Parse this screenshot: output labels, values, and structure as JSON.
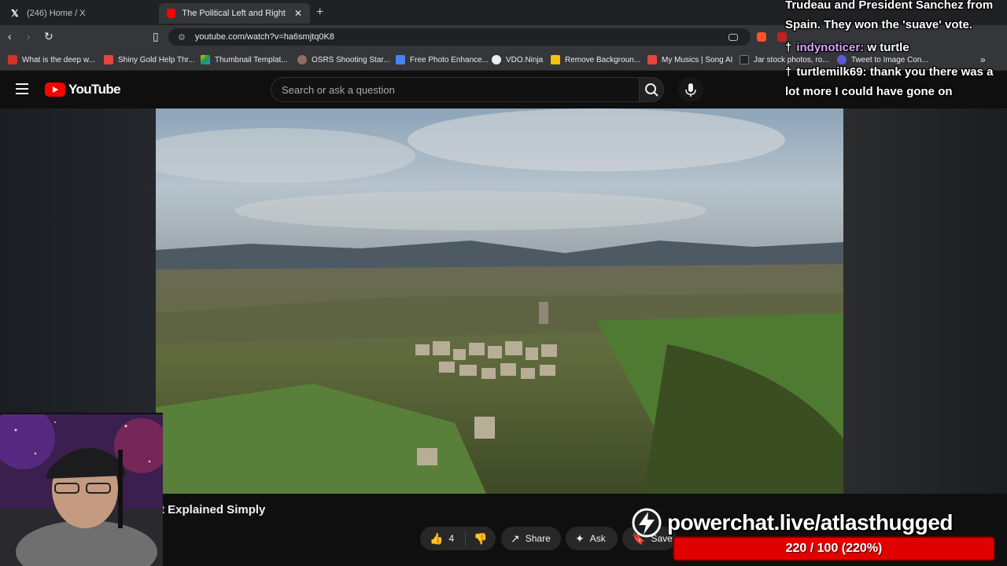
{
  "browser": {
    "tabs": [
      {
        "title": "(246) Home / X",
        "active": false
      },
      {
        "title": "The Political Left and Right Expla",
        "active": true
      }
    ],
    "url": "youtube.com/watch?v=ha6smjtq0K8",
    "bookmarks": [
      {
        "label": "What is the deep w...",
        "color": "#d93025"
      },
      {
        "label": "Shiny Gold Help Thr...",
        "color": "#e8453c"
      },
      {
        "label": "Thumbnail Templat...",
        "color": "#f4b400"
      },
      {
        "label": "OSRS Shooting Star...",
        "color": "#8d6e63"
      },
      {
        "label": "Free Photo Enhance...",
        "color": "#4285f4"
      },
      {
        "label": "VDO.Ninja",
        "color": "#eeeeee"
      },
      {
        "label": "Remove Backgroun...",
        "color": "#f4c20d"
      },
      {
        "label": "My Musics | Song AI",
        "color": "#e8453c"
      },
      {
        "label": "Jar stock photos, ro...",
        "color": "#222222"
      },
      {
        "label": "Tweet to Image Con...",
        "color": "#5b5bd6"
      }
    ]
  },
  "youtube": {
    "logo_text": "YouTube",
    "search_placeholder": "Search or ask a question",
    "video_title": "t Explained Simply",
    "actions": {
      "like_count": "4",
      "share": "Share",
      "ask": "Ask",
      "save": "Save"
    }
  },
  "chat": {
    "lines": [
      {
        "text": "Trudeau and President Sanchez from Spain. They won the 'suave' vote."
      },
      {
        "user": "indynoticer:",
        "text": "w turtle"
      },
      {
        "user": "turtlemilk69:",
        "text": "thank you there was a lot more I could have gone on"
      }
    ]
  },
  "powerchat": {
    "brand": "powerchat.live/atlasthugged",
    "goal_text": "220 / 100 (220%)",
    "goal_fraction": 2.2
  },
  "colors": {
    "yt_red": "#ff0000",
    "goal_bar": "#e00000",
    "chat_user": "#d8a6ff"
  }
}
